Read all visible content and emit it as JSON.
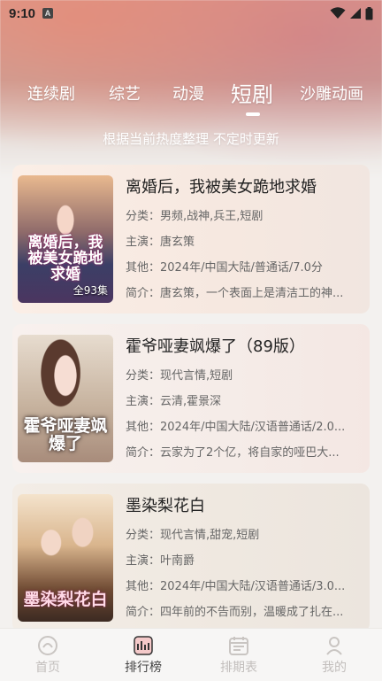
{
  "status_bar": {
    "time": "9:10",
    "notification_icon": "A"
  },
  "tabs": [
    {
      "label": "连续剧",
      "active": false
    },
    {
      "label": "综艺",
      "active": false
    },
    {
      "label": "动漫",
      "active": false
    },
    {
      "label": "短剧",
      "active": true
    },
    {
      "label": "沙雕动画",
      "active": false
    }
  ],
  "subtitle": "根据当前热度整理 不定时更新",
  "labels": {
    "category": "分类：",
    "cast": "主演：",
    "other": "其他：",
    "intro": "简介："
  },
  "items": [
    {
      "title": "离婚后，我被美女跪地求婚",
      "category": "男频,战神,兵王,短剧",
      "cast": "唐玄策",
      "other": "2024年/中国大陆/普通话/7.0分",
      "intro": "唐玄策，一个表面上是清洁工的神...",
      "poster_text": "离婚后，我被美女跪地求婚",
      "episodes": "全93集"
    },
    {
      "title": "霍爷哑妻飒爆了（89版）",
      "category": "现代言情,短剧",
      "cast": "云清,霍景深",
      "other": "2024年/中国大陆/汉语普通话/2.0...",
      "intro": "云家为了2个亿，将自家的哑巴大...",
      "poster_text": "霍爷哑妻飒爆了",
      "episodes": ""
    },
    {
      "title": "墨染梨花白",
      "category": "现代言情,甜宠,短剧",
      "cast": "叶南爵",
      "other": "2024年/中国大陆/汉语普通话/3.0...",
      "intro": "四年前的不告而别，温暖成了扎在...",
      "poster_text": "墨染梨花白",
      "episodes": ""
    }
  ],
  "bottom_nav": [
    {
      "label": "首页",
      "icon": "home-icon",
      "active": false
    },
    {
      "label": "排行榜",
      "icon": "ranking-icon",
      "active": true
    },
    {
      "label": "排期表",
      "icon": "calendar-icon",
      "active": false
    },
    {
      "label": "我的",
      "icon": "profile-icon",
      "active": false
    }
  ]
}
